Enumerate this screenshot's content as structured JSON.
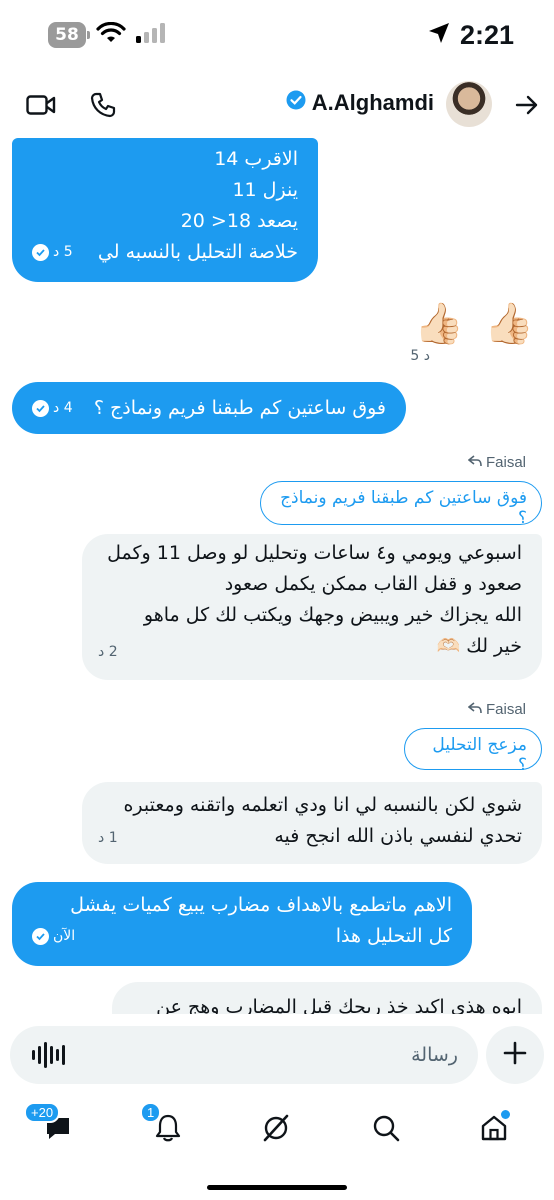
{
  "status": {
    "battery": "58",
    "time": "2:21"
  },
  "header": {
    "name": "A.Alghamdi",
    "icons": [
      "video-icon",
      "phone-icon",
      "verified-icon",
      "forward-arrow-icon"
    ]
  },
  "messages": {
    "m1": {
      "lines": [
        "الاقرب 14",
        "ينزل 11",
        "يصعد 18< 20",
        "خلاصة التحليل بالنسبه لي"
      ],
      "time": "5 د"
    },
    "m2": {
      "emoji": "👍🏻👍🏻",
      "time": "5 د"
    },
    "m3": {
      "text": "فوق ساعتين كم طبقنا فريم ونماذج ؟",
      "time": "4 د"
    },
    "m4": {
      "reply_to": "Faisal",
      "quote": "فوق ساعتين كم طبقنا فريم ونماذج ؟",
      "lines": [
        "اسبوعي ويومي و٤ ساعات وتحليل لو وصل 11 وكمل",
        "صعود و قفل القاب ممكن يكمل صعود",
        "الله يجزاك خير ويبيض وجهك ويكتب لك كل ماهو",
        "خير لك 🫶🏻"
      ],
      "time": "2 د"
    },
    "m5": {
      "reply_to": "Faisal",
      "quote": "مزعج التحليل ؟",
      "lines": [
        "شوي لكن بالنسبه لي انا ودي اتعلمه واتقنه ومعتبره",
        "تحدي لنفسي باذن الله انجح فيه"
      ],
      "time": "1 د"
    },
    "m6": {
      "lines": [
        "الاهم ماتطمع بالاهداف مضارب يبيع كميات يفشل",
        "كل التحليل هذا"
      ],
      "time": "الآن"
    },
    "m7": {
      "text": "ايوه هذي اكيد خذ ربحك قبل المضارب وهج عن"
    }
  },
  "composer": {
    "placeholder": "رسالة"
  },
  "nav": {
    "messages_badge": "+20",
    "notifications_badge": "1"
  },
  "colors": {
    "accent": "#1d9bf0",
    "bubble_grey": "#eff3f4",
    "text": "#0f1419"
  }
}
